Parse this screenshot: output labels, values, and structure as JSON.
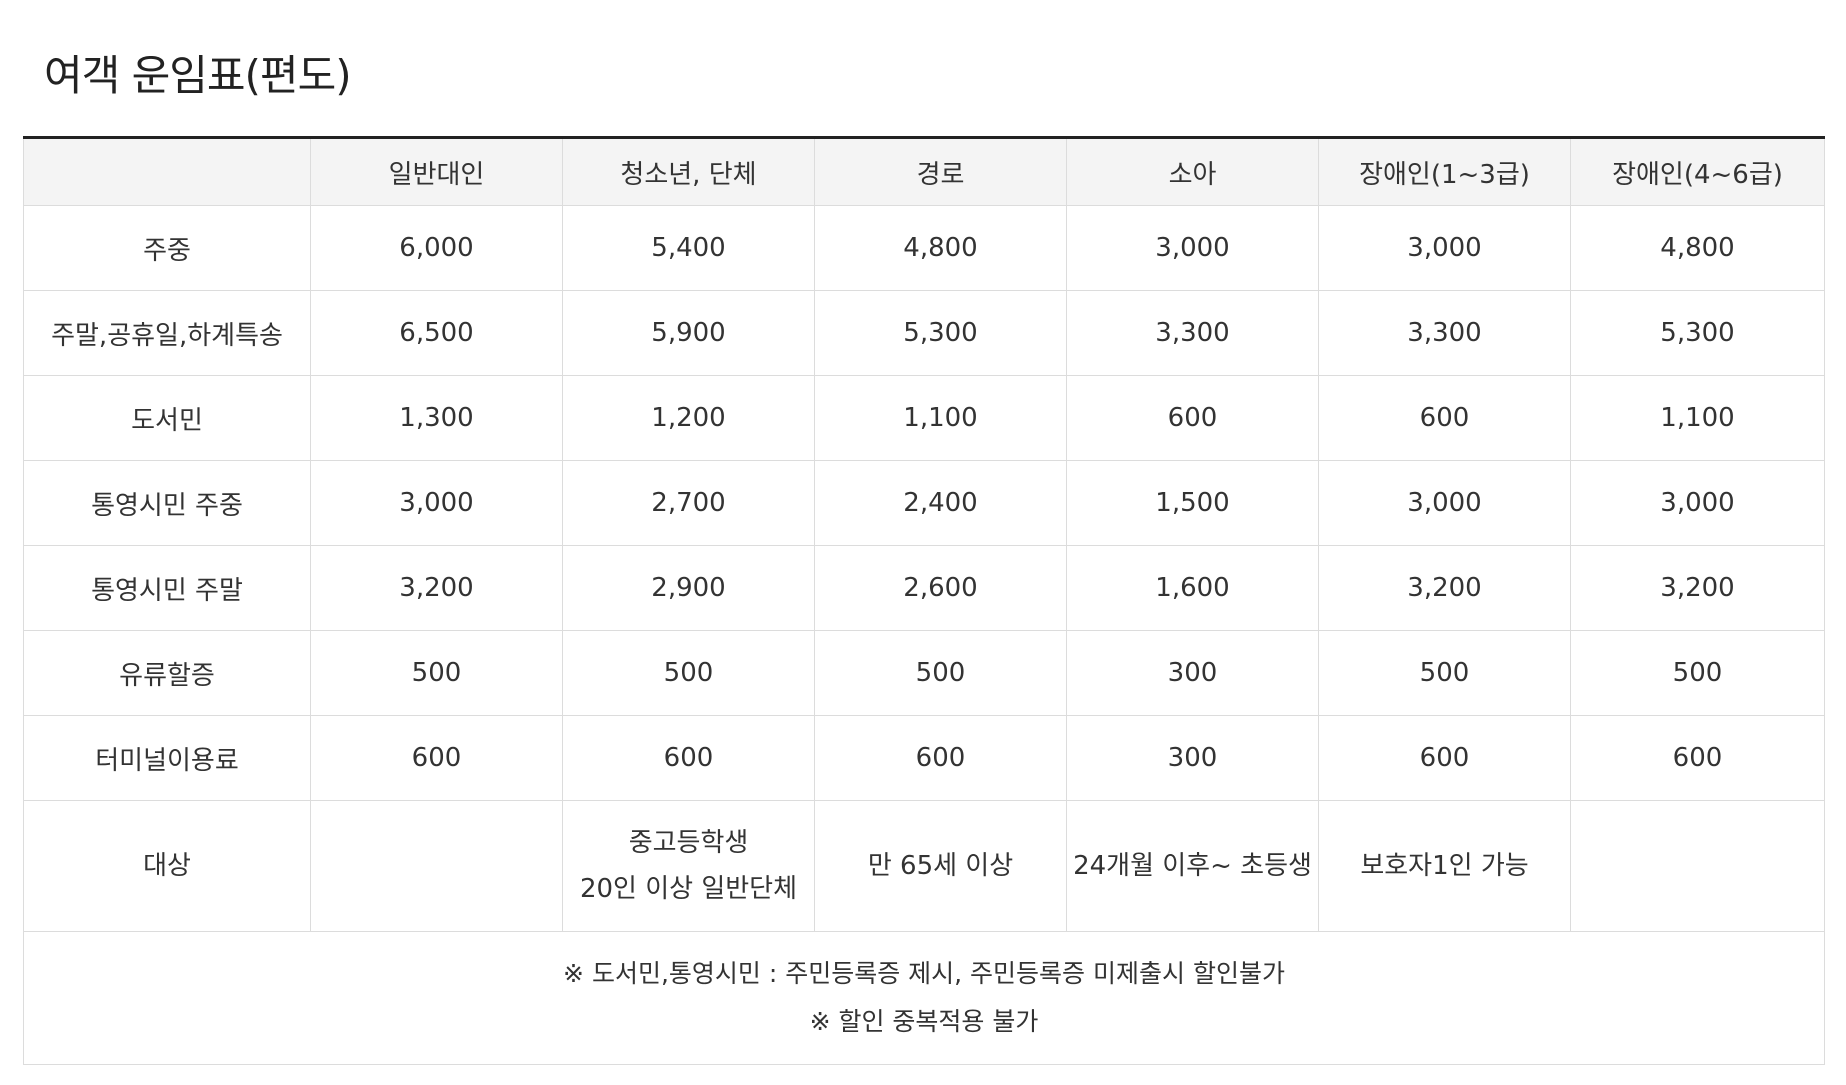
{
  "title": "여객 운임표(편도)",
  "table": {
    "headers": [
      "",
      "일반대인",
      "청소년, 단체",
      "경로",
      "소아",
      "장애인(1~3급)",
      "장애인(4~6급)"
    ],
    "rows": [
      {
        "label": "주중",
        "values": [
          "6,000",
          "5,400",
          "4,800",
          "3,000",
          "3,000",
          "4,800"
        ]
      },
      {
        "label": "주말,공휴일,하계특송",
        "values": [
          "6,500",
          "5,900",
          "5,300",
          "3,300",
          "3,300",
          "5,300"
        ]
      },
      {
        "label": "도서민",
        "values": [
          "1,300",
          "1,200",
          "1,100",
          "600",
          "600",
          "1,100"
        ]
      },
      {
        "label": "통영시민 주중",
        "values": [
          "3,000",
          "2,700",
          "2,400",
          "1,500",
          "3,000",
          "3,000"
        ]
      },
      {
        "label": "통영시민 주말",
        "values": [
          "3,200",
          "2,900",
          "2,600",
          "1,600",
          "3,200",
          "3,200"
        ]
      },
      {
        "label": "유류할증",
        "values": [
          "500",
          "500",
          "500",
          "300",
          "500",
          "500"
        ]
      },
      {
        "label": "터미널이용료",
        "values": [
          "600",
          "600",
          "600",
          "300",
          "600",
          "600"
        ]
      }
    ],
    "target_row": {
      "label": "대상",
      "values": [
        [],
        [
          "중고등학생",
          "20인 이상 일반단체"
        ],
        [
          "만 65세 이상"
        ],
        [
          "24개월 이후~ 초등생"
        ],
        [
          "보호자1인 가능"
        ],
        []
      ]
    },
    "notes": [
      "※ 도서민,통영시민 : 주민등록증 제시, 주민등록증 미제출시 할인불가",
      "※ 할인 중복적용 불가"
    ]
  }
}
